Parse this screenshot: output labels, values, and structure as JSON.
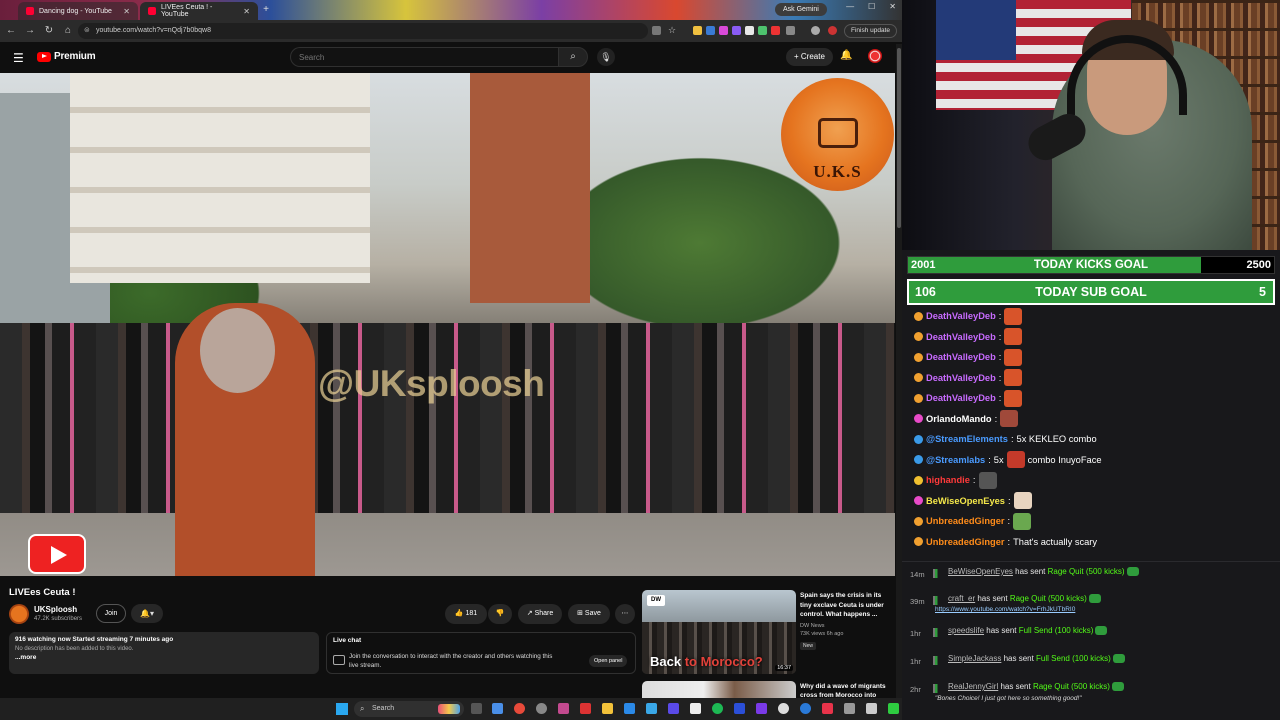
{
  "browser": {
    "tabs": [
      {
        "label": "Dancing dog - YouTube"
      },
      {
        "label": "LIVEes Ceuta ! - YouTube"
      }
    ],
    "ask_gemini": "Ask Gemini",
    "url": "youtube.com/watch?v=nQdj7b0bqw8",
    "finish_update": "Finish update"
  },
  "youtube": {
    "logo": "Premium",
    "search_placeholder": "Search",
    "create_label": "+ Create",
    "video": {
      "watermark": "@UKsploosh",
      "badge_text": "U.K.S",
      "title": "LIVEes Ceuta !",
      "channel": "UKSploosh",
      "subscribers": "47.2K subscribers",
      "join_label": "Join",
      "likes": "181",
      "share_label": "Share",
      "save_label": "Save",
      "watching": "916 watching now  Started streaming 7 minutes ago",
      "no_description": "No description has been added to this video.",
      "more": "...more"
    },
    "live_chat": {
      "heading": "Live chat",
      "text": "Join the conversation to interact with the creator and others watching this live stream.",
      "open_panel": "Open panel"
    },
    "recommendations": [
      {
        "caption_plain": "Back",
        "caption_red": "to Morocco?",
        "duration": "16:37",
        "title": "Spain says the crisis in its tiny exclave Ceuta is under control. What happens ...",
        "channel": "DW News",
        "meta": "73K views  6h ago",
        "badge": "New",
        "logo": "DW"
      },
      {
        "title": "Why did a wave of migrants cross from Morocco into"
      }
    ]
  },
  "taskbar": {
    "search_label": "Search"
  },
  "overlay": {
    "kicks_goal": {
      "current": "2001",
      "label": "TODAY KICKS GOAL",
      "target": "2500",
      "progress": 0.8
    },
    "sub_goal": {
      "current": "106",
      "label": "TODAY SUB GOAL",
      "target": "5"
    },
    "chat": [
      {
        "user": "DeathValleyDeb",
        "suffix": ":",
        "text": "",
        "color": "#c86bff"
      },
      {
        "user": "DeathValleyDeb",
        "suffix": ":",
        "text": "",
        "color": "#c86bff"
      },
      {
        "user": "DeathValleyDeb",
        "suffix": ":",
        "text": "",
        "color": "#c86bff"
      },
      {
        "user": "DeathValleyDeb",
        "suffix": ":",
        "text": "",
        "color": "#c86bff"
      },
      {
        "user": "DeathValleyDeb",
        "suffix": ":",
        "text": "",
        "color": "#c86bff"
      },
      {
        "user": "OrlandoMando",
        "suffix": ":",
        "text": "",
        "color": "#ffffff"
      },
      {
        "user": "@StreamElements",
        "suffix": ":",
        "text": "5x KEKLEO combo",
        "color": "#4a9bff"
      },
      {
        "user": "@Streamlabs",
        "suffix": ":",
        "text": "5x",
        "text2": "combo InuyoFace",
        "color": "#4a9bff"
      },
      {
        "user": "highandie",
        "suffix": ":",
        "text": "",
        "color": "#ff3a3a"
      },
      {
        "user": "BeWiseOpenEyes",
        "suffix": ":",
        "text": "",
        "color": "#f5e84a"
      },
      {
        "user": "UnbreadedGinger",
        "suffix": ":",
        "text": "",
        "color": "#ff8c1a"
      },
      {
        "user": "UnbreadedGinger",
        "suffix": ":",
        "text": "That's actually scary",
        "color": "#ff8c1a"
      }
    ],
    "alerts": [
      {
        "time": "14m",
        "user": "BeWiseOpenEyes",
        "mid": " has sent ",
        "item": "Rage Quit (500 kicks)",
        "note": ""
      },
      {
        "time": "39m",
        "user": "craft_er",
        "mid": " has sent ",
        "item": "Rage Quit (500 kicks)",
        "note": "https://www.youtube.com/watch?v=FrhJkUTbRI0"
      },
      {
        "time": "1hr",
        "user": "speedslife",
        "mid": " has sent ",
        "item": "Full Send (100 kicks)",
        "note": ""
      },
      {
        "time": "1hr",
        "user": "SimpleJackass",
        "mid": " has sent ",
        "item": "Full Send (100 kicks)",
        "note": ""
      },
      {
        "time": "2hr",
        "user": "RealJennyGirl",
        "mid": " has sent ",
        "item": "Rage Quit (500 kicks)",
        "note": "\"Bones Choice! I just got here so something good!\""
      }
    ]
  }
}
